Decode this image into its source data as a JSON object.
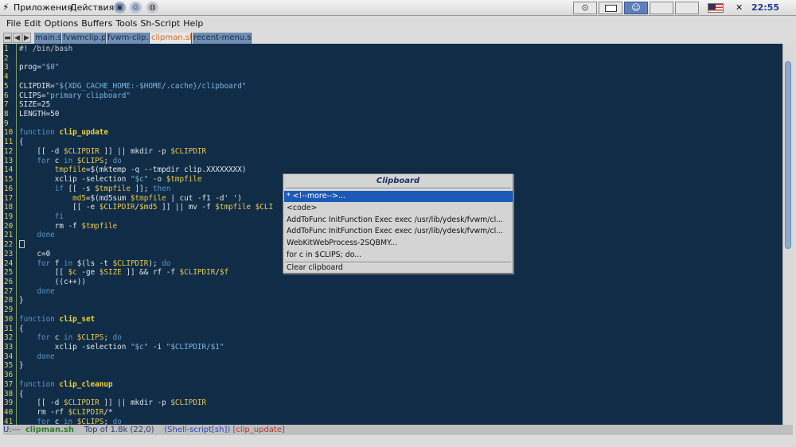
{
  "panel": {
    "menu_apps": "Приложения",
    "menu_actions": "Действия",
    "clock": "22:55",
    "close_glyph": "✕",
    "flag_icon": "us-flag-icon",
    "pager_glyphs": [
      "⊙",
      "",
      "☺",
      "",
      "",
      ""
    ]
  },
  "emacs": {
    "menubar": [
      "File",
      "Edit",
      "Options",
      "Buffers",
      "Tools",
      "Sh-Script",
      "Help"
    ],
    "tabbar": {
      "buttons": [
        "▬",
        "◀",
        "▶"
      ],
      "tabs": [
        {
          "label": "main.s",
          "current": false
        },
        {
          "label": "fvwmclip.p",
          "current": false
        },
        {
          "label": "fvwm-clip.p",
          "current": false
        },
        {
          "label": "clipman.sh",
          "current": true
        },
        {
          "label": "recent-menu.sh",
          "current": false
        }
      ]
    },
    "lines": [
      [
        [
          "cm",
          "#! /bin/bash"
        ]
      ],
      [],
      [
        [
          "",
          "prog="
        ],
        [
          "st",
          "\"$0\""
        ]
      ],
      [],
      [
        [
          "",
          "CLIPDIR="
        ],
        [
          "st",
          "\"${XDG_CACHE_HOME:-$HOME/.cache}/clipboard\""
        ]
      ],
      [
        [
          "",
          "CLIPS="
        ],
        [
          "st",
          "\"primary clipboard\""
        ]
      ],
      [
        [
          "",
          "SIZE=25"
        ]
      ],
      [
        [
          "",
          "LENGTH=50"
        ]
      ],
      [],
      [
        [
          "kw",
          "function "
        ],
        [
          "fn",
          "clip_update"
        ]
      ],
      [
        [
          "",
          "{"
        ]
      ],
      [
        [
          "",
          "    [[ -d "
        ],
        [
          "vr",
          "$CLIPDIR"
        ],
        [
          "",
          " ]] || mkdir -p "
        ],
        [
          "vr",
          "$CLIPDIR"
        ]
      ],
      [
        [
          "kw",
          "    for"
        ],
        [
          "",
          " c "
        ],
        [
          "kw",
          "in"
        ],
        [
          "",
          " "
        ],
        [
          "vr",
          "$CLIPS"
        ],
        [
          "",
          "; "
        ],
        [
          "kw",
          "do"
        ]
      ],
      [
        [
          "",
          "        "
        ],
        [
          "vr",
          "tmpfile"
        ],
        [
          "",
          "=$(mktemp -q --tmpdir clip.XXXXXXXX)"
        ]
      ],
      [
        [
          "",
          "        xclip -selection "
        ],
        [
          "st",
          "\"$c\""
        ],
        [
          "",
          " -o "
        ],
        [
          "vr",
          "$tmpfile"
        ]
      ],
      [
        [
          "kw",
          "        if"
        ],
        [
          "",
          " [[ -s "
        ],
        [
          "vr",
          "$tmpfile"
        ],
        [
          "",
          " ]]; "
        ],
        [
          "kw",
          "then"
        ]
      ],
      [
        [
          "",
          "            "
        ],
        [
          "vr",
          "md5"
        ],
        [
          "",
          "=$(md5sum "
        ],
        [
          "vr",
          "$tmpfile"
        ],
        [
          "",
          " | cut -f1 -d' ')"
        ]
      ],
      [
        [
          "",
          "            [[ -e "
        ],
        [
          "vr",
          "$CLIPDIR"
        ],
        [
          "",
          "/"
        ],
        [
          "vr",
          "$md5"
        ],
        [
          "",
          " ]] || mv -f "
        ],
        [
          "vr",
          "$tmpfile"
        ],
        [
          "",
          " "
        ],
        [
          "vr",
          "$CLI"
        ]
      ],
      [
        [
          "kw",
          "        fi"
        ]
      ],
      [
        [
          "",
          "        rm -f "
        ],
        [
          "vr",
          "$tmpfile"
        ]
      ],
      [
        [
          "kw",
          "    done"
        ]
      ],
      [
        [
          "caret",
          ""
        ]
      ],
      [
        [
          "",
          "    c=0"
        ]
      ],
      [
        [
          "kw",
          "    for"
        ],
        [
          "",
          " f "
        ],
        [
          "kw",
          "in"
        ],
        [
          "",
          " $(ls -t "
        ],
        [
          "vr",
          "$CLIPDIR"
        ],
        [
          "",
          "); "
        ],
        [
          "kw",
          "do"
        ]
      ],
      [
        [
          "",
          "        [[ "
        ],
        [
          "vr",
          "$c"
        ],
        [
          "",
          " -ge "
        ],
        [
          "vr",
          "$SIZE"
        ],
        [
          "",
          " ]] && rf -f "
        ],
        [
          "vr",
          "$CLIPDIR"
        ],
        [
          "",
          "/"
        ],
        [
          "vr",
          "$f"
        ]
      ],
      [
        [
          "",
          "        ((c++))"
        ]
      ],
      [
        [
          "kw",
          "    done"
        ]
      ],
      [
        [
          "",
          "}"
        ]
      ],
      [],
      [
        [
          "kw",
          "function "
        ],
        [
          "fn",
          "clip_set"
        ]
      ],
      [
        [
          "",
          "{"
        ]
      ],
      [
        [
          "kw",
          "    for"
        ],
        [
          "",
          " c "
        ],
        [
          "kw",
          "in"
        ],
        [
          "",
          " "
        ],
        [
          "vr",
          "$CLIPS"
        ],
        [
          "",
          "; "
        ],
        [
          "kw",
          "do"
        ]
      ],
      [
        [
          "",
          "        xclip -selection "
        ],
        [
          "st",
          "\"$c\""
        ],
        [
          "",
          " -i "
        ],
        [
          "st",
          "\"$CLIPDIR/$1\""
        ]
      ],
      [
        [
          "kw",
          "    done"
        ]
      ],
      [
        [
          "",
          "}"
        ]
      ],
      [],
      [
        [
          "kw",
          "function "
        ],
        [
          "fn",
          "clip_cleanup"
        ]
      ],
      [
        [
          "",
          "{"
        ]
      ],
      [
        [
          "",
          "    [[ -d "
        ],
        [
          "vr",
          "$CLIPDIR"
        ],
        [
          "",
          " ]] || mkdir -p "
        ],
        [
          "vr",
          "$CLIPDIR"
        ]
      ],
      [
        [
          "",
          "    rm -rf "
        ],
        [
          "vr",
          "$CLIPDIR"
        ],
        [
          "",
          "/*"
        ]
      ],
      [
        [
          "kw",
          "    for"
        ],
        [
          "",
          " c "
        ],
        [
          "kw",
          "in"
        ],
        [
          "",
          " "
        ],
        [
          "vr",
          "$CLIPS"
        ],
        [
          "",
          "; "
        ],
        [
          "kw",
          "do"
        ]
      ]
    ],
    "modeline": {
      "state": "U:---",
      "buffer": "clipman.sh",
      "position": "Top of 1.8k (22,0)",
      "mode": "(Shell-script[sh])",
      "function": "[clip_update]"
    }
  },
  "popup": {
    "title": "Clipboard",
    "items": [
      {
        "label": "* <!--more-->...",
        "selected": true
      },
      {
        "label": "<code>",
        "selected": false
      },
      {
        "label": "AddToFunc InitFunction Exec exec /usr/lib/ydesk/fvwm/cl...",
        "selected": false
      },
      {
        "label": "AddToFunc InitFunction Exec exec /usr/lib/ydesk/fvwm/cl...",
        "selected": false
      },
      {
        "label": "WebKitWebProcess-2SQBMY...",
        "selected": false
      },
      {
        "label": "    for c in $CLIPS; do...",
        "selected": false
      }
    ],
    "clear_label": "Clear clipboard"
  }
}
